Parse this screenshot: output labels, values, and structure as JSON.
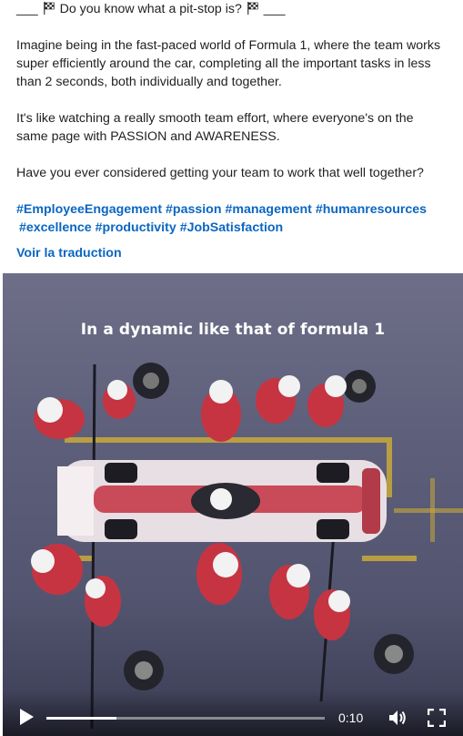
{
  "post": {
    "headline_prefix": "___",
    "headline_text": "Do you know what a pit-stop is?",
    "headline_suffix": "___",
    "headline_icon": "checkered-flag-icon",
    "para1_line1": "Imagine being in the fast-paced world of Formula 1, where the team works",
    "para1_line2": "super efficiently around the car, completing all the important tasks in less",
    "para1_line3": "than 2 seconds, both individually and together.",
    "para2_line1": "It's like watching a really smooth team effort, where everyone's on the",
    "para2_line2": "same page with PASSION and AWARENESS.",
    "para3_line1": "Have you ever considered getting your team to work that well together?",
    "hashtags": [
      "#EmployeeEngagement",
      "#passion",
      "#management",
      "#humanresources",
      "#excellence",
      "#productivity",
      "#JobSatisfaction"
    ],
    "translate_label": "Voir la traduction",
    "link_color": "#0a66c2"
  },
  "video": {
    "caption": "In a dynamic like that of formula 1",
    "current_time": "0:10",
    "progress": 0.25,
    "play_icon": "play-icon",
    "volume_icon": "volume-icon",
    "fullscreen_icon": "fullscreen-icon"
  }
}
